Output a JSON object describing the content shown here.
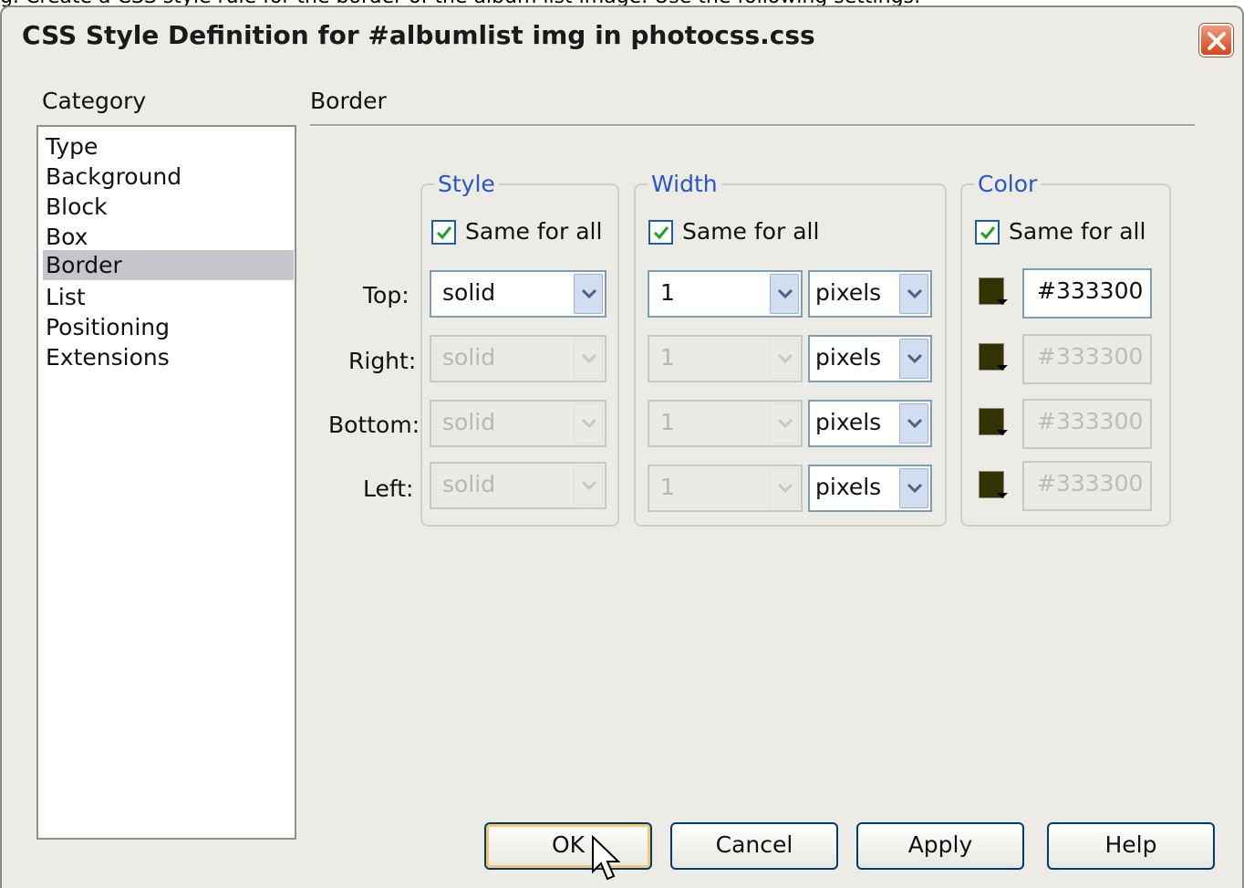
{
  "background_text": "g. Create a CSS style rule for the border of the album list image. Use the following settings:",
  "dialog": {
    "title": "CSS Style Definition for #albumlist img in photocss.css"
  },
  "category": {
    "label": "Category",
    "items": [
      "Type",
      "Background",
      "Block",
      "Box",
      "Border",
      "List",
      "Positioning",
      "Extensions"
    ],
    "selected": "Border"
  },
  "panel": {
    "title": "Border"
  },
  "row_labels": [
    "Top:",
    "Right:",
    "Bottom:",
    "Left:"
  ],
  "style_group": {
    "title": "Style",
    "same_for_all": "Same for all",
    "values": [
      "solid",
      "solid",
      "solid",
      "solid"
    ]
  },
  "width_group": {
    "title": "Width",
    "same_for_all": "Same for all",
    "values": [
      "1",
      "1",
      "1",
      "1"
    ],
    "units": [
      "pixels",
      "pixels",
      "pixels",
      "pixels"
    ]
  },
  "color_group": {
    "title": "Color",
    "same_for_all": "Same for all",
    "values": [
      "#333300",
      "#333300",
      "#333300",
      "#333300"
    ],
    "swatch_color": "#333300"
  },
  "buttons": {
    "ok": "OK",
    "cancel": "Cancel",
    "apply": "Apply",
    "help": "Help"
  }
}
